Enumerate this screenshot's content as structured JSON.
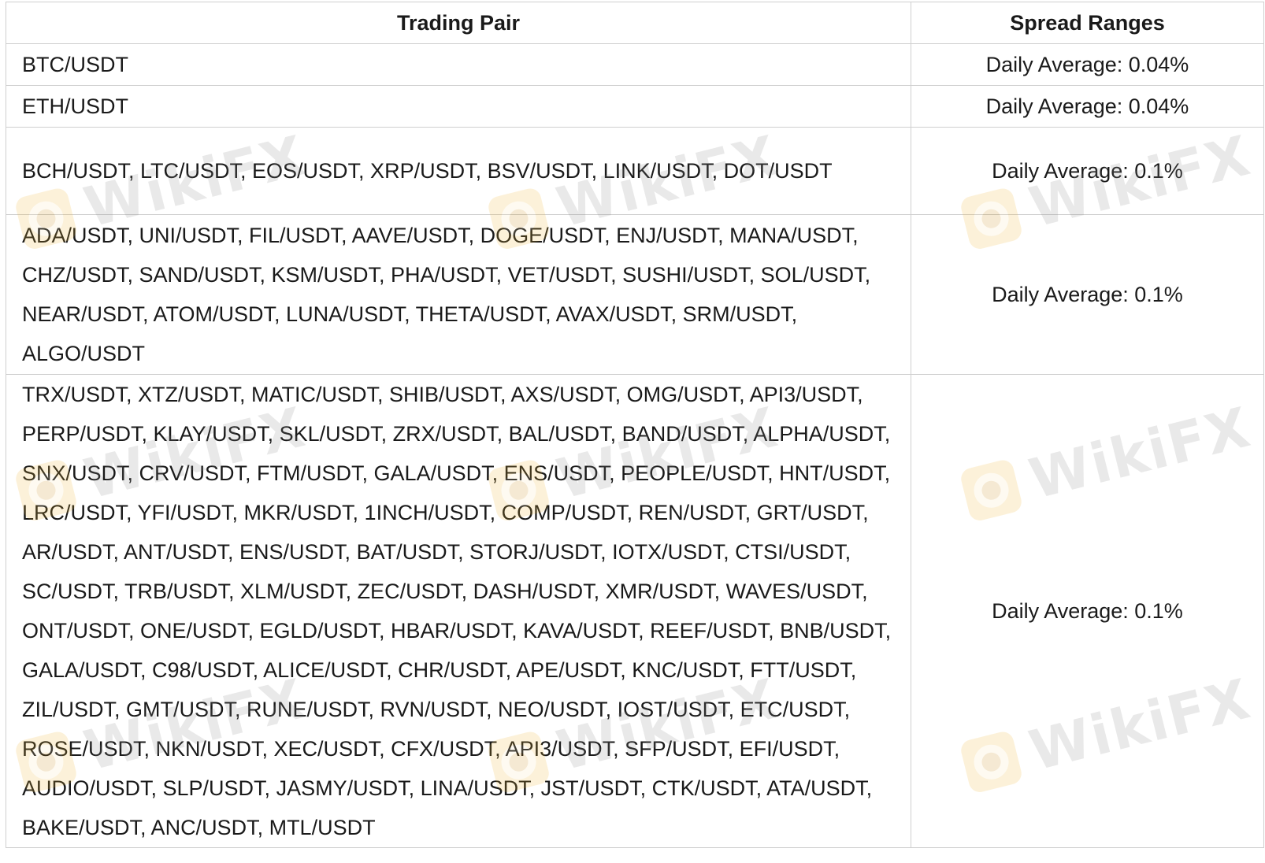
{
  "table": {
    "headers": {
      "trading_pair": "Trading Pair",
      "spread_ranges": "Spread Ranges"
    },
    "rows": [
      {
        "pairs": "BTC/USDT",
        "spread": "Daily Average: 0.04%"
      },
      {
        "pairs": "ETH/USDT",
        "spread": "Daily Average: 0.04%"
      },
      {
        "pairs": "BCH/USDT, LTC/USDT, EOS/USDT, XRP/USDT, BSV/USDT, LINK/USDT, DOT/USDT",
        "spread": "Daily Average: 0.1%"
      },
      {
        "pairs": "ADA/USDT, UNI/USDT, FIL/USDT, AAVE/USDT, DOGE/USDT, ENJ/USDT, MANA/USDT, CHZ/USDT, SAND/USDT, KSM/USDT, PHA/USDT, VET/USDT, SUSHI/USDT, SOL/USDT, NEAR/USDT, ATOM/USDT, LUNA/USDT, THETA/USDT, AVAX/USDT, SRM/USDT, ALGO/USDT",
        "spread": "Daily Average: 0.1%"
      },
      {
        "pairs": "TRX/USDT, XTZ/USDT, MATIC/USDT, SHIB/USDT, AXS/USDT, OMG/USDT, API3/USDT, PERP/USDT, KLAY/USDT, SKL/USDT, ZRX/USDT, BAL/USDT, BAND/USDT, ALPHA/USDT, SNX/USDT, CRV/USDT, FTM/USDT, GALA/USDT, ENS/USDT, PEOPLE/USDT, HNT/USDT, LRC/USDT, YFI/USDT, MKR/USDT, 1INCH/USDT, COMP/USDT, REN/USDT, GRT/USDT, AR/USDT, ANT/USDT, ENS/USDT, BAT/USDT, STORJ/USDT, IOTX/USDT, CTSI/USDT, SC/USDT, TRB/USDT, XLM/USDT, ZEC/USDT, DASH/USDT, XMR/USDT, WAVES/USDT, ONT/USDT, ONE/USDT, EGLD/USDT, HBAR/USDT, KAVA/USDT, REEF/USDT, BNB/USDT, GALA/USDT, C98/USDT, ALICE/USDT, CHR/USDT, APE/USDT, KNC/USDT, FTT/USDT, ZIL/USDT, GMT/USDT, RUNE/USDT, RVN/USDT, NEO/USDT, IOST/USDT, ETC/USDT, ROSE/USDT, NKN/USDT, XEC/USDT, CFX/USDT, API3/USDT, SFP/USDT, EFI/USDT, AUDIO/USDT, SLP/USDT, JASMY/USDT, LINA/USDT, JST/USDT, CTK/USDT, ATA/USDT, BAKE/USDT, ANC/USDT, MTL/USDT",
        "spread": "Daily Average: 0.1%"
      }
    ]
  },
  "watermark": {
    "text": "WikiFX",
    "accent_color": "#f2b832"
  }
}
